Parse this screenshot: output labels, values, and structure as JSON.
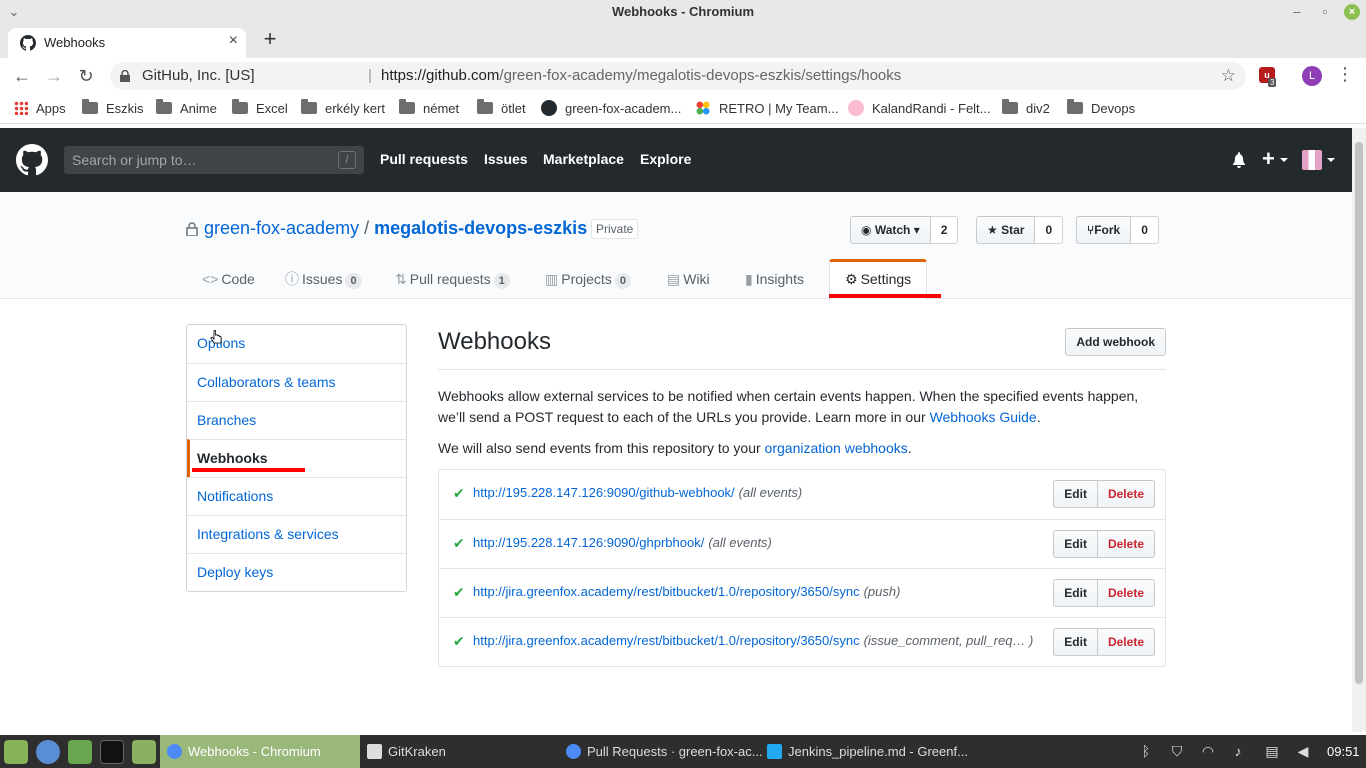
{
  "window": {
    "title": "Webhooks - Chromium"
  },
  "browser": {
    "tab_title": "Webhooks",
    "omnibox": {
      "org": "GitHub, Inc. [US]",
      "url_host": "https://github.com",
      "url_path": "/green-fox-academy/megalotis-devops-eszkis/settings/hooks"
    },
    "extension_count": "3",
    "profile_initial": "L",
    "bookmarks": [
      {
        "label": "Apps"
      },
      {
        "label": "Eszkis"
      },
      {
        "label": "Anime"
      },
      {
        "label": "Excel"
      },
      {
        "label": "erkély kert"
      },
      {
        "label": "német"
      },
      {
        "label": "ötlet"
      },
      {
        "label": "green-fox-academ..."
      },
      {
        "label": "RETRO | My Team..."
      },
      {
        "label": "KalandRandi - Felt..."
      },
      {
        "label": "div2"
      },
      {
        "label": "Devops"
      }
    ]
  },
  "github": {
    "search_placeholder": "Search or jump to…",
    "search_key": "/",
    "nav": [
      "Pull requests",
      "Issues",
      "Marketplace",
      "Explore"
    ],
    "repo": {
      "owner": "green-fox-academy",
      "separator": "/",
      "name": "megalotis-devops-eszkis",
      "visibility": "Private",
      "watch": {
        "label": "Watch",
        "count": "2"
      },
      "star": {
        "label": "Star",
        "count": "0"
      },
      "fork": {
        "label": "Fork",
        "count": "0"
      }
    },
    "tabs": [
      {
        "label": "Code",
        "icon": "<>"
      },
      {
        "label": "Issues",
        "count": "0"
      },
      {
        "label": "Pull requests",
        "count": "1"
      },
      {
        "label": "Projects",
        "count": "0"
      },
      {
        "label": "Wiki"
      },
      {
        "label": "Insights"
      },
      {
        "label": "Settings"
      }
    ],
    "settings_menu": [
      "Options",
      "Collaborators & teams",
      "Branches",
      "Webhooks",
      "Notifications",
      "Integrations & services",
      "Deploy keys"
    ],
    "webhooks": {
      "title": "Webhooks",
      "add_button": "Add webhook",
      "desc_part1": "Webhooks allow external services to be notified when certain events happen. When the specified events happen, we’ll send a POST request to each of the URLs you provide. Learn more in our ",
      "desc_link": "Webhooks Guide",
      "desc_end": ".",
      "desc2_part1": "We will also send events from this repository to your ",
      "desc2_link": "organization webhooks",
      "desc2_end": ".",
      "edit_label": "Edit",
      "delete_label": "Delete",
      "hooks": [
        {
          "url": "http://195.228.147.126:9090/github-webhook/",
          "events": "(all events)"
        },
        {
          "url": "http://195.228.147.126:9090/ghprbhook/",
          "events": "(all events)"
        },
        {
          "url": "http://jira.greenfox.academy/rest/bitbucket/1.0/repository/3650/sync",
          "events": "(push)"
        },
        {
          "url": "http://jira.greenfox.academy/rest/bitbucket/1.0/repository/3650/sync",
          "events": "(issue_comment, pull_req… )"
        }
      ]
    }
  },
  "taskbar": {
    "windows": [
      {
        "label": "Webhooks - Chromium"
      },
      {
        "label": "GitKraken"
      },
      {
        "label": "Pull Requests · green-fox-ac..."
      },
      {
        "label": "Jenkins_pipeline.md - Greenf..."
      }
    ],
    "clock": "09:51"
  },
  "colors": {
    "accent_red": "#ff0000",
    "github_header": "#24292e",
    "link": "#0366d6",
    "mint_active": "#9ab87a"
  }
}
